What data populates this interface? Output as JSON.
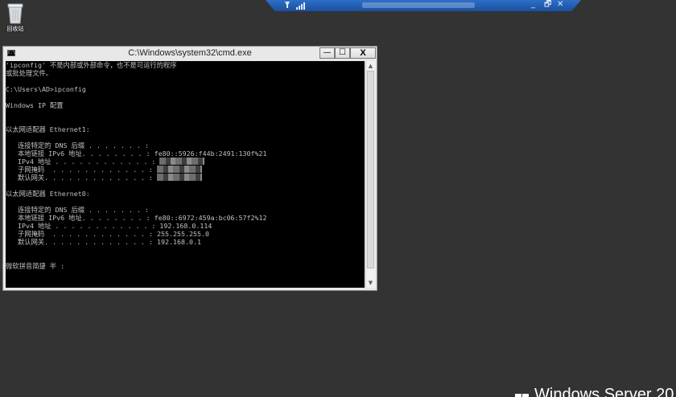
{
  "desktop": {
    "recycle_bin_label": "回收站",
    "icon": "recycle-bin-icon"
  },
  "rdp_bar": {
    "pin_icon": "pin-icon",
    "signal_icon": "signal-icon",
    "minimize": "_",
    "restore": "🗗",
    "close": "✕"
  },
  "window": {
    "title": "C:\\Windows\\system32\\cmd.exe",
    "icon_label": "C:\\",
    "minimize": "—",
    "maximize": "☐",
    "close": "X"
  },
  "console": {
    "lines": [
      "'ipconfig' 不是内部或外部命令，也不是可运行的程序",
      "或批处理文件。",
      "",
      "C:\\Users\\AD>ipconfig",
      "",
      "Windows IP 配置",
      "",
      "",
      "以太网适配器 Ethernet1:",
      "",
      "   连接特定的 DNS 后缀 . . . . . . . :",
      "   本地链接 IPv6 地址. . . . . . . . : fe80::5926:f44b:2491:130f%21",
      "   IPv4 地址 . . . . . . . . . . . . :",
      "   子网掩码  . . . . . . . . . . . . :",
      "   默认网关. . . . . . . . . . . . . :",
      "",
      "以太网适配器 Ethernet0:",
      "",
      "   连接特定的 DNS 后缀 . . . . . . . :",
      "   本地链接 IPv6 地址. . . . . . . . : fe80::6972:459a:bc06:57f2%12",
      "   IPv4 地址 . . . . . . . . . . . . : 192.168.0.114",
      "   子网掩码  . . . . . . . . . . . . : 255.255.255.0",
      "   默认网关. . . . . . . . . . . . . : 192.168.0.1",
      "",
      "",
      "微软拼音简捷 半 :"
    ],
    "redacted_rows": [
      12,
      13,
      14
    ]
  },
  "scrollbar": {
    "up": "▲",
    "down": "▼"
  },
  "watermark": {
    "text": "Windows Server 20"
  }
}
